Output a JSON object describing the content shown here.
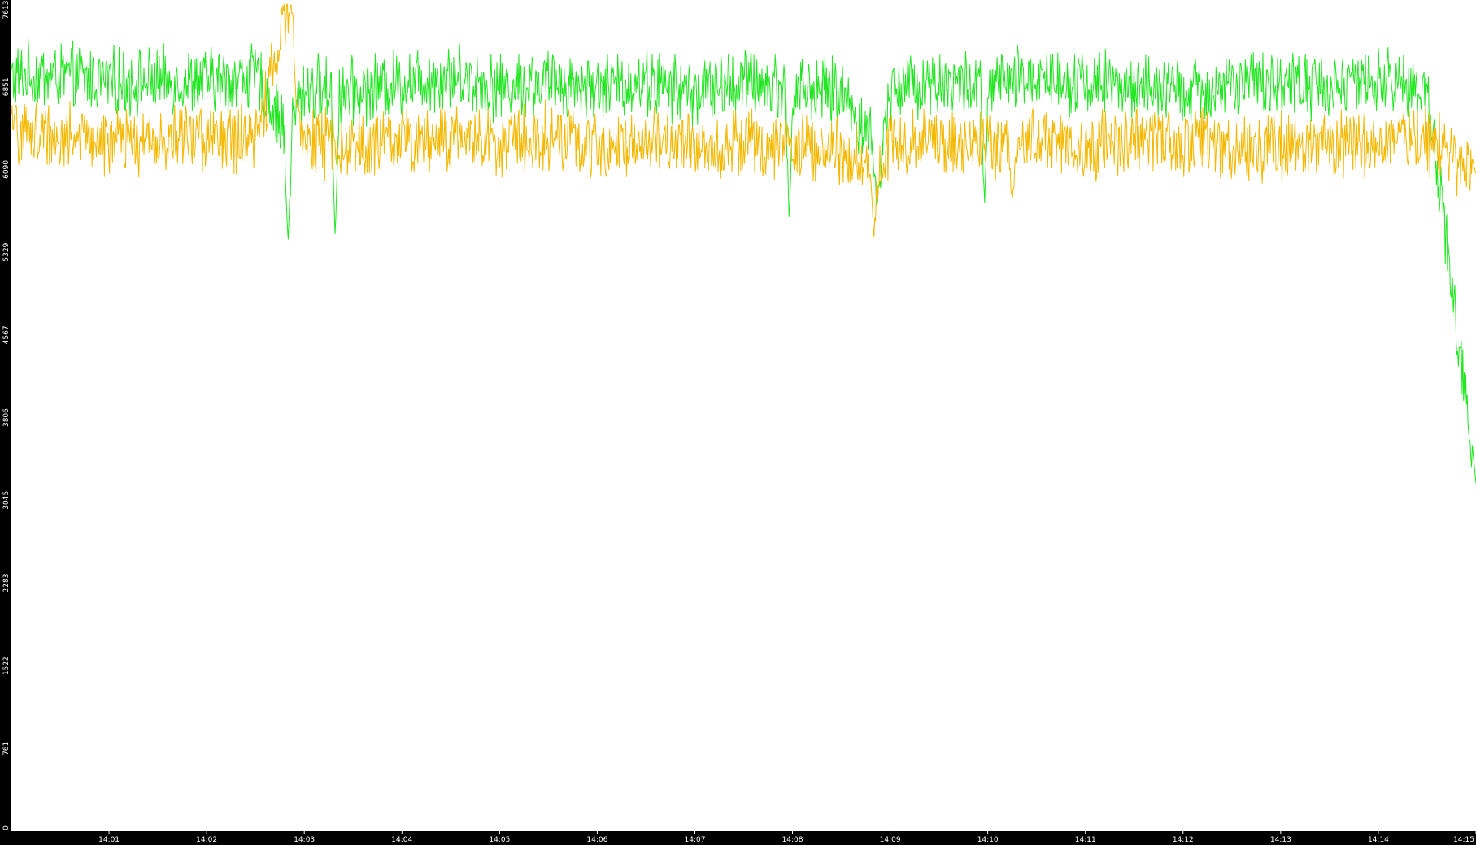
{
  "chart_data": {
    "type": "line",
    "title": "",
    "xlabel": "",
    "ylabel": "",
    "ylim": [
      0,
      7613
    ],
    "yticks": [
      "0",
      "761",
      "1522",
      "2283",
      "3045",
      "3806",
      "4567",
      "5329",
      "6090",
      "6851",
      "7613"
    ],
    "xticks": [
      "14:01",
      "14:02",
      "14:03",
      "14:04",
      "14:05",
      "14:06",
      "14:07",
      "14:08",
      "14:09",
      "14:10",
      "14:11",
      "14:12",
      "14:13",
      "14:14",
      "14:15"
    ],
    "xlim": [
      "14:00",
      "14:15"
    ],
    "grid": false,
    "legend": "none",
    "colors": {
      "background": "#ffffff",
      "axis_bar": "#000000",
      "series_green": "#22e622",
      "series_amber": "#f5b800"
    },
    "series": [
      {
        "color": "#22e622",
        "x": [
          "14:00",
          "14:00:30",
          "14:01",
          "14:01:30",
          "14:02",
          "14:02:30",
          "14:02:50",
          "14:03",
          "14:03:30",
          "14:04",
          "14:04:30",
          "14:05",
          "14:05:30",
          "14:06",
          "14:06:30",
          "14:07",
          "14:07:30",
          "14:08",
          "14:08:30",
          "14:08:55",
          "14:09",
          "14:09:30",
          "14:10",
          "14:10:30",
          "14:11",
          "14:11:30",
          "14:12",
          "14:12:30",
          "14:13",
          "14:13:30",
          "14:14",
          "14:14:30",
          "14:15"
        ],
        "y": [
          6950,
          6950,
          6900,
          6900,
          6900,
          6950,
          6400,
          6850,
          6800,
          6900,
          6950,
          6850,
          6900,
          6850,
          6900,
          6800,
          6900,
          6850,
          6800,
          6200,
          6850,
          6900,
          6850,
          6950,
          6900,
          6850,
          6800,
          6850,
          6900,
          6850,
          6900,
          6850,
          3200
        ],
        "mean": 6880,
        "spikes": [
          {
            "x": "14:02:50",
            "y": 5400
          },
          {
            "x": "14:03:19",
            "y": 5440
          },
          {
            "x": "14:07:58",
            "y": 5600
          },
          {
            "x": "14:08:52",
            "y": 5720
          },
          {
            "x": "14:09:58",
            "y": 5760
          }
        ]
      },
      {
        "color": "#f5b800",
        "x": [
          "14:00",
          "14:00:30",
          "14:01",
          "14:01:30",
          "14:02",
          "14:02:30",
          "14:02:50",
          "14:03",
          "14:03:30",
          "14:04",
          "14:04:30",
          "14:05",
          "14:05:30",
          "14:06",
          "14:06:30",
          "14:07",
          "14:07:30",
          "14:08",
          "14:08:30",
          "14:08:55",
          "14:09",
          "14:09:30",
          "14:10",
          "14:10:30",
          "14:11",
          "14:11:30",
          "14:12",
          "14:12:30",
          "14:13",
          "14:13:30",
          "14:14",
          "14:14:30",
          "14:15"
        ],
        "y": [
          6450,
          6400,
          6350,
          6350,
          6400,
          6350,
          7550,
          6350,
          6300,
          6350,
          6400,
          6350,
          6400,
          6300,
          6350,
          6300,
          6350,
          6300,
          6250,
          6100,
          6350,
          6350,
          6300,
          6350,
          6300,
          6350,
          6350,
          6300,
          6300,
          6350,
          6300,
          6350,
          6050
        ],
        "mean": 6320,
        "spikes": [
          {
            "x": "14:02:52",
            "y": 7613
          },
          {
            "x": "14:08:50",
            "y": 5440
          },
          {
            "x": "14:10:15",
            "y": 5810
          }
        ]
      }
    ]
  }
}
